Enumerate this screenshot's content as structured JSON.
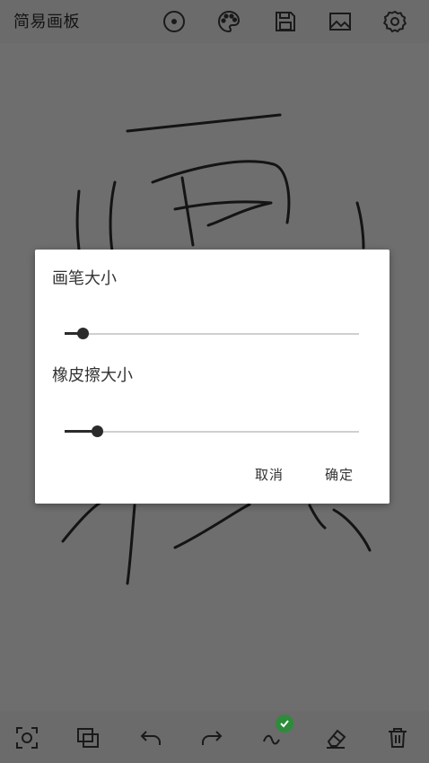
{
  "app": {
    "title": "简易画板"
  },
  "toolbar_top": {
    "icons": [
      "circle-dot-icon",
      "palette-icon",
      "save-icon",
      "image-icon",
      "settings-icon"
    ]
  },
  "toolbar_bottom": {
    "icons": [
      "fullscreen-icon",
      "layers-icon",
      "undo-icon",
      "redo-icon",
      "brush-stroke-icon",
      "eraser-icon",
      "trash-icon"
    ],
    "active_badge": "checkmark-icon"
  },
  "dialog": {
    "pen_size_label": "画笔大小",
    "pen_size_fraction": 0.06,
    "eraser_size_label": "橡皮擦大小",
    "eraser_size_fraction": 0.11,
    "cancel_label": "取消",
    "confirm_label": "确定"
  },
  "colors": {
    "accent": "#2e8b3a",
    "icon": "#1a1a1a",
    "overlay_bg": "#6e6e6e",
    "dialog_bg": "#ffffff"
  }
}
